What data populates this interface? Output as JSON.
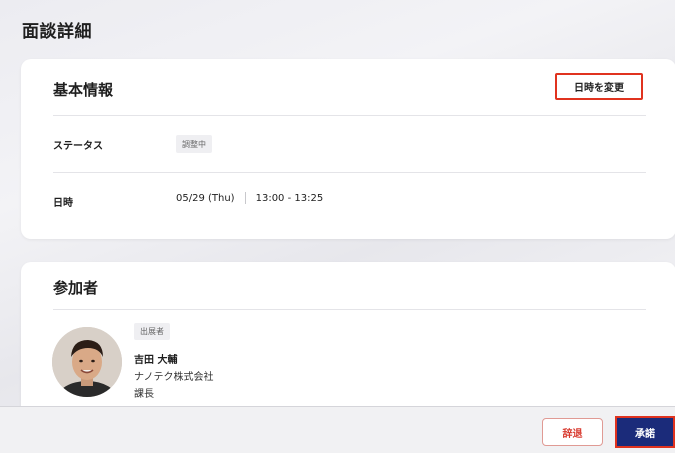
{
  "page": {
    "title": "面談詳細"
  },
  "basic_info": {
    "title": "基本情報",
    "change_button": "日時を変更",
    "status_label": "ステータス",
    "status_value": "調整中",
    "date_label": "日時",
    "date_value": "05/29 (Thu)",
    "time_value": "13:00 - 13:25"
  },
  "participants": {
    "title": "参加者",
    "items": [
      {
        "role": "出展者",
        "name": "吉田 大輔",
        "company": "ナノテク株式会社",
        "position": "課長",
        "avatar_icon": "person-photo"
      }
    ]
  },
  "footer": {
    "decline_label": "辞退",
    "accept_label": "承諾"
  },
  "colors": {
    "accent_navy": "#1b2b7a",
    "highlight_red": "#e0331f",
    "decline_red": "#d83a2f"
  }
}
